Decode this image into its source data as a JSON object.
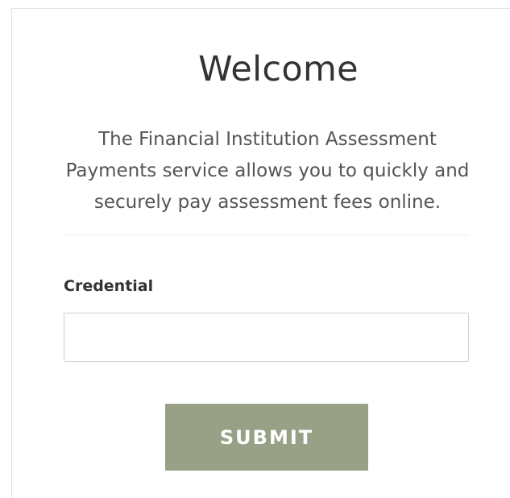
{
  "welcome": {
    "title": "Welcome",
    "description": "The Financial Institution Assessment Payments service allows you to quickly and securely pay assessment fees online."
  },
  "form": {
    "credential_label": "Credential",
    "credential_value": "",
    "credential_placeholder": "",
    "submit_label": "SUBMIT"
  },
  "colors": {
    "submit_button": "#98a185",
    "title_text": "#333333",
    "body_text": "#555555"
  }
}
